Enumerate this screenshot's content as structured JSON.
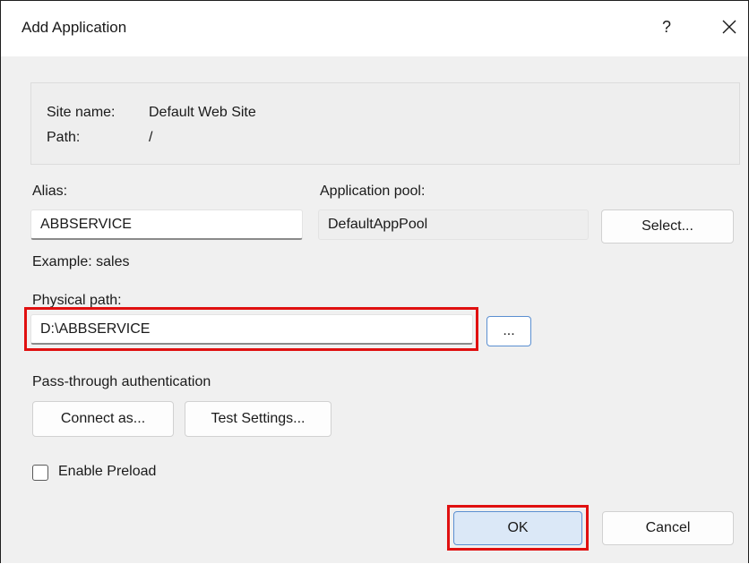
{
  "window": {
    "title": "Add Application",
    "help_label": "?"
  },
  "site_info": {
    "site_name_label": "Site name:",
    "site_name_value": "Default Web Site",
    "path_label": "Path:",
    "path_value": "/"
  },
  "alias": {
    "label": "Alias:",
    "value": "ABBSERVICE",
    "example": "Example: sales"
  },
  "app_pool": {
    "label": "Application pool:",
    "value": "DefaultAppPool",
    "select_label": "Select..."
  },
  "physical_path": {
    "label": "Physical path:",
    "value": "D:\\ABBSERVICE",
    "browse_label": "..."
  },
  "pass_through": {
    "label": "Pass-through authentication",
    "connect_as_label": "Connect as...",
    "test_settings_label": "Test Settings..."
  },
  "preload": {
    "label": "Enable Preload",
    "checked": false
  },
  "footer": {
    "ok_label": "OK",
    "cancel_label": "Cancel"
  },
  "colors": {
    "highlight": "#e01010",
    "primary_border": "#5b8fd1",
    "dialog_bg": "#f0f0f0"
  }
}
